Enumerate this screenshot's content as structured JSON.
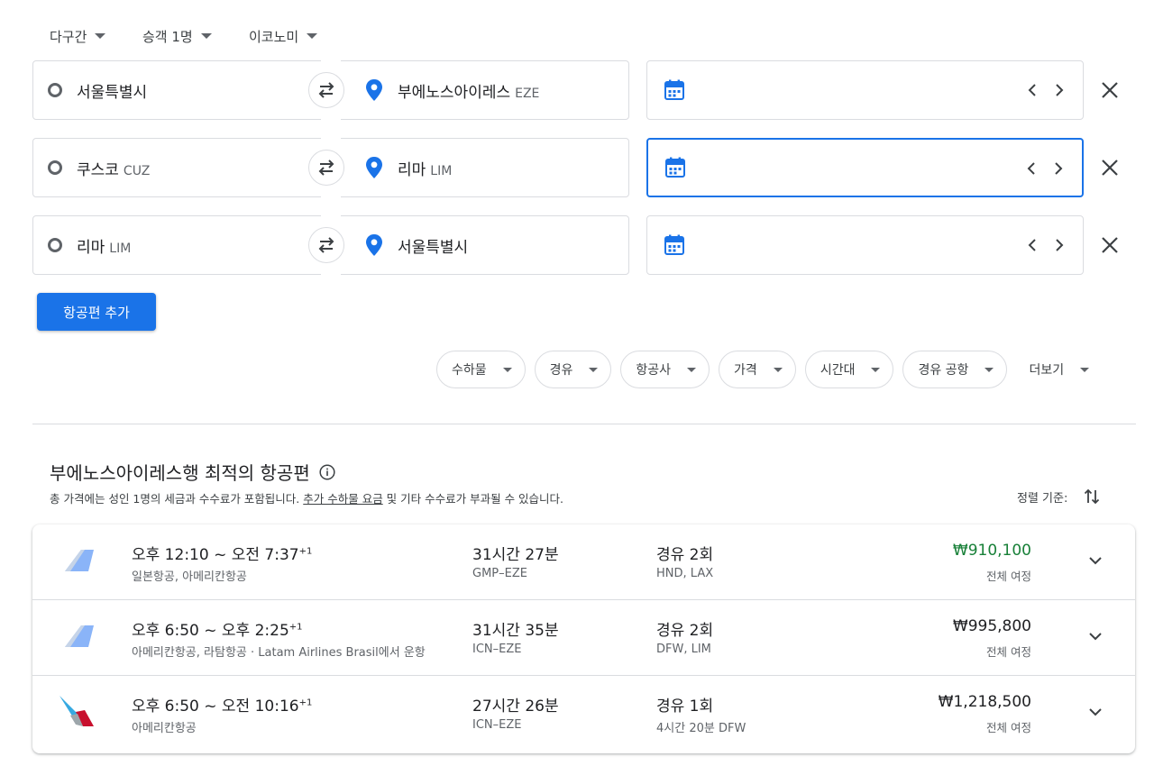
{
  "topbar": {
    "trip_type": "다구간",
    "passengers": "승객 1명",
    "cabin": "이코노미"
  },
  "legs": [
    {
      "from_name": "서울특별시",
      "from_code": "",
      "to_name": "부에노스아이레스",
      "to_code": "EZE",
      "active": false
    },
    {
      "from_name": "쿠스코",
      "from_code": "CUZ",
      "to_name": "리마",
      "to_code": "LIM",
      "active": true
    },
    {
      "from_name": "리마",
      "from_code": "LIM",
      "to_name": "서울특별시",
      "to_code": "",
      "active": false
    }
  ],
  "add_flight_label": "항공편 추가",
  "filters": [
    "수하물",
    "경유",
    "항공사",
    "가격",
    "시간대",
    "경유 공항"
  ],
  "more_label": "더보기",
  "results": {
    "title": "부에노스아이레스행 최적의 항공편",
    "subtitle_pre": "총 가격에는 성인 1명의 세금과 수수료가 포함됩니다. ",
    "subtitle_link": "추가 수하물 요금",
    "subtitle_post": " 및 기타 수수료가 부과될 수 있습니다.",
    "sort_label": "정렬 기준:"
  },
  "flights": [
    {
      "time": "오후 12:10 ~ 오전 7:37",
      "plus": "+1",
      "airline": "일본항공, 아메리칸항공",
      "duration": "31시간 27분",
      "route": "GMP–EZE",
      "stops": "경유 2회",
      "stop_info": "HND, LAX",
      "price": "₩910,100",
      "price_note": "전체 여정",
      "cheapest": true,
      "logo": "generic-plane-tail"
    },
    {
      "time": "오후 6:50 ~ 오후 2:25",
      "plus": "+1",
      "airline": "아메리칸항공, 라탐항공 · Latam Airlines Brasil에서 운항",
      "duration": "31시간 35분",
      "route": "ICN–EZE",
      "stops": "경유 2회",
      "stop_info": "DFW, LIM",
      "price": "₩995,800",
      "price_note": "전체 여정",
      "cheapest": false,
      "logo": "generic-plane-tail"
    },
    {
      "time": "오후 6:50 ~ 오전 10:16",
      "plus": "+1",
      "airline": "아메리칸항공",
      "duration": "27시간 26분",
      "route": "ICN–EZE",
      "stops": "경유 1회",
      "stop_info": "4시간 20분 DFW",
      "price": "₩1,218,500",
      "price_note": "전체 여정",
      "cheapest": false,
      "logo": "american-airlines-logo"
    }
  ],
  "colors": {
    "accent": "#1a73e8",
    "price_green": "#188038",
    "border": "#dadce0"
  }
}
